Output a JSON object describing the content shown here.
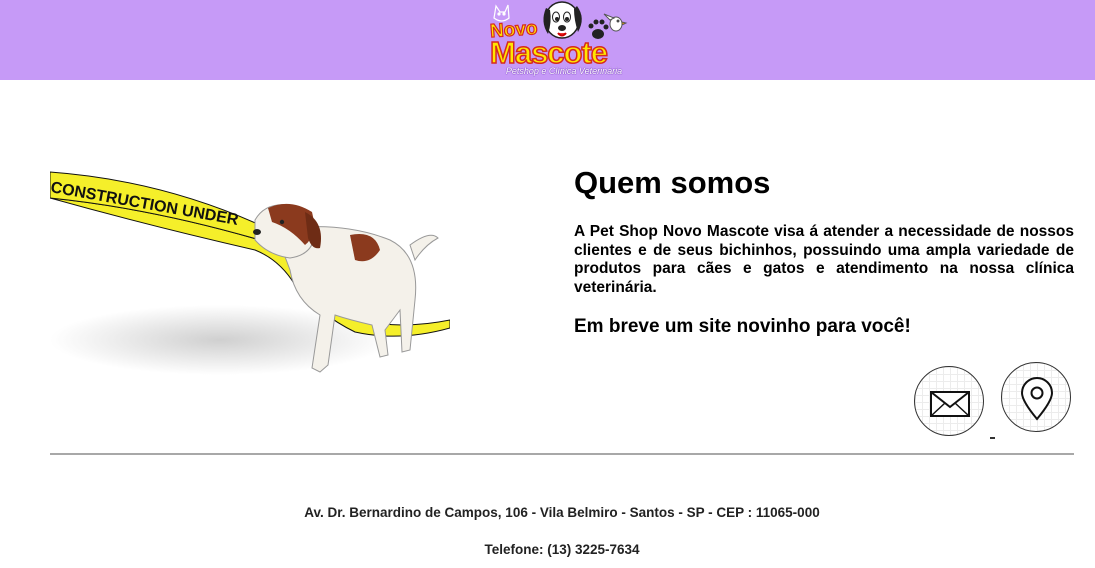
{
  "header": {
    "background": "#c69af7",
    "logo": {
      "word1": "Novo",
      "word2": "Mascote",
      "tagline": "Petshop e Clínica Veterinária",
      "text_color": "#ffe600"
    }
  },
  "hero": {
    "tape_text": "CONSTRUCTION UNDER",
    "tape_color": "#f5ef2a"
  },
  "about": {
    "title": "Quem somos",
    "text": "A Pet Shop Novo Mascote visa á atender a necessidade de nossos clientes e de seus bichinhos, possuindo uma ampla variedade de produtos para cães e gatos e atendimento na nossa clínica veterinária.",
    "soon": "Em breve um site novinho para você!"
  },
  "contact_icons": [
    "mail-icon",
    "map-pin-icon"
  ],
  "footer": {
    "address": "Av. Dr. Bernardino de Campos, 106 - Vila Belmiro - Santos - SP - CEP : 11065-000",
    "phone": "Telefone: (13) 3225-7634"
  }
}
